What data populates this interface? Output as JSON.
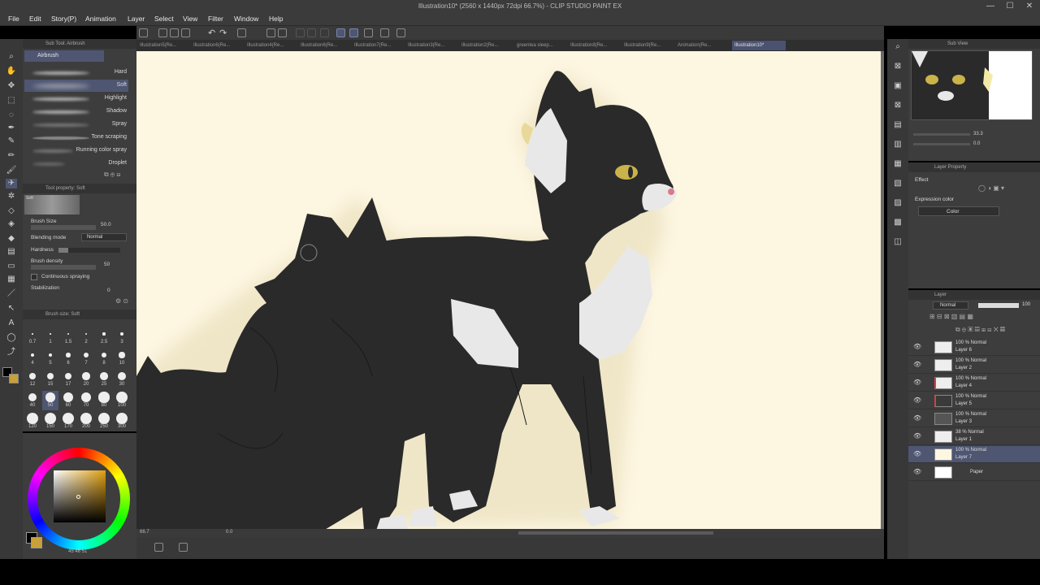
{
  "window": {
    "title": "Illustration10* (2560 x 1440px 72dpi 66.7%)  - CLIP STUDIO PAINT EX",
    "minimize": "—",
    "maximize": "☐",
    "close": "✕"
  },
  "menu": [
    "File",
    "Edit",
    "Story(P)",
    "Animation",
    "Layer",
    "Select",
    "View",
    "Filter",
    "Window",
    "Help"
  ],
  "tabs": [
    {
      "label": "Illustration5(Re..."
    },
    {
      "label": "Illustration6(Re..."
    },
    {
      "label": "Illustration4(Re..."
    },
    {
      "label": "Illustration6(Re..."
    },
    {
      "label": "Illustration7(Re..."
    },
    {
      "label": "Illustration3(Re..."
    },
    {
      "label": "Illustration2(Re..."
    },
    {
      "label": "greentea sleep..."
    },
    {
      "label": "Illustration8(Re..."
    },
    {
      "label": "Illustration9(Re..."
    },
    {
      "label": "Animation(Re..."
    },
    {
      "label": "Illustration10*",
      "active": true
    }
  ],
  "subtool": {
    "header": "Sub Tool: Airbrush",
    "group": "Airbrush",
    "brushes": [
      {
        "label": "Hard"
      },
      {
        "label": "Soft",
        "selected": true
      },
      {
        "label": "Highlight"
      },
      {
        "label": "Shadow"
      },
      {
        "label": "Spray"
      },
      {
        "label": "Tone scraping"
      },
      {
        "label": "Running color spray"
      },
      {
        "label": "Droplet"
      }
    ]
  },
  "toolprop": {
    "header": "Tool property: Soft",
    "preview_label": "Soft",
    "brush_size_label": "Brush Size",
    "brush_size_value": "50.0",
    "blending_label": "Blending mode",
    "blending_value": "Normal",
    "hardness_label": "Hardness",
    "density_label": "Brush density",
    "density_value": "50",
    "continuous_label": "Continuous spraying",
    "stabilization_label": "Stabilization",
    "stabilization_value": "0"
  },
  "brushsize": {
    "header": "Brush size: Soft",
    "sizes": [
      "0.7",
      "1",
      "1.5",
      "2",
      "2.5",
      "3",
      "4",
      "5",
      "6",
      "7",
      "8",
      "10",
      "12",
      "15",
      "17",
      "20",
      "25",
      "30",
      "40",
      "50",
      "60",
      "70",
      "80",
      "100",
      "120",
      "150",
      "170",
      "200",
      "250",
      "300"
    ],
    "selected_size": "50"
  },
  "color": {
    "main": "#000000",
    "sub": "#c8a13a",
    "readout": "45  48  51"
  },
  "status": {
    "zoom": "66.7",
    "angle": "0.0"
  },
  "subview": {
    "header": "Sub View",
    "zoom": "33.3",
    "angle": "0.0"
  },
  "layerprop": {
    "header": "Layer Property",
    "effect_label": "Effect",
    "expression_label": "Expression color",
    "expression_value": "Color"
  },
  "layers": {
    "header": "Layer",
    "blend_mode": "Normal",
    "opacity": "100",
    "items": [
      {
        "mode": "100 % Normal",
        "name": "Layer 6"
      },
      {
        "mode": "100 % Normal",
        "name": "Layer 2"
      },
      {
        "mode": "100 % Normal",
        "name": "Layer 4"
      },
      {
        "mode": "100 % Normal",
        "name": "Layer 5"
      },
      {
        "mode": "100 % Normal",
        "name": "Layer 3"
      },
      {
        "mode": "38 % Normal",
        "name": "Layer 1"
      },
      {
        "mode": "100 % Normal",
        "name": "Layer 7",
        "selected": true
      },
      {
        "mode": "",
        "name": "Paper"
      }
    ]
  },
  "colors": {
    "canvas": "#fdf6e1",
    "cat_fur": "#2a2a2a",
    "white_fur": "#e8e8e8",
    "eye": "#c9b34a",
    "accent_select": "#4e5672"
  }
}
